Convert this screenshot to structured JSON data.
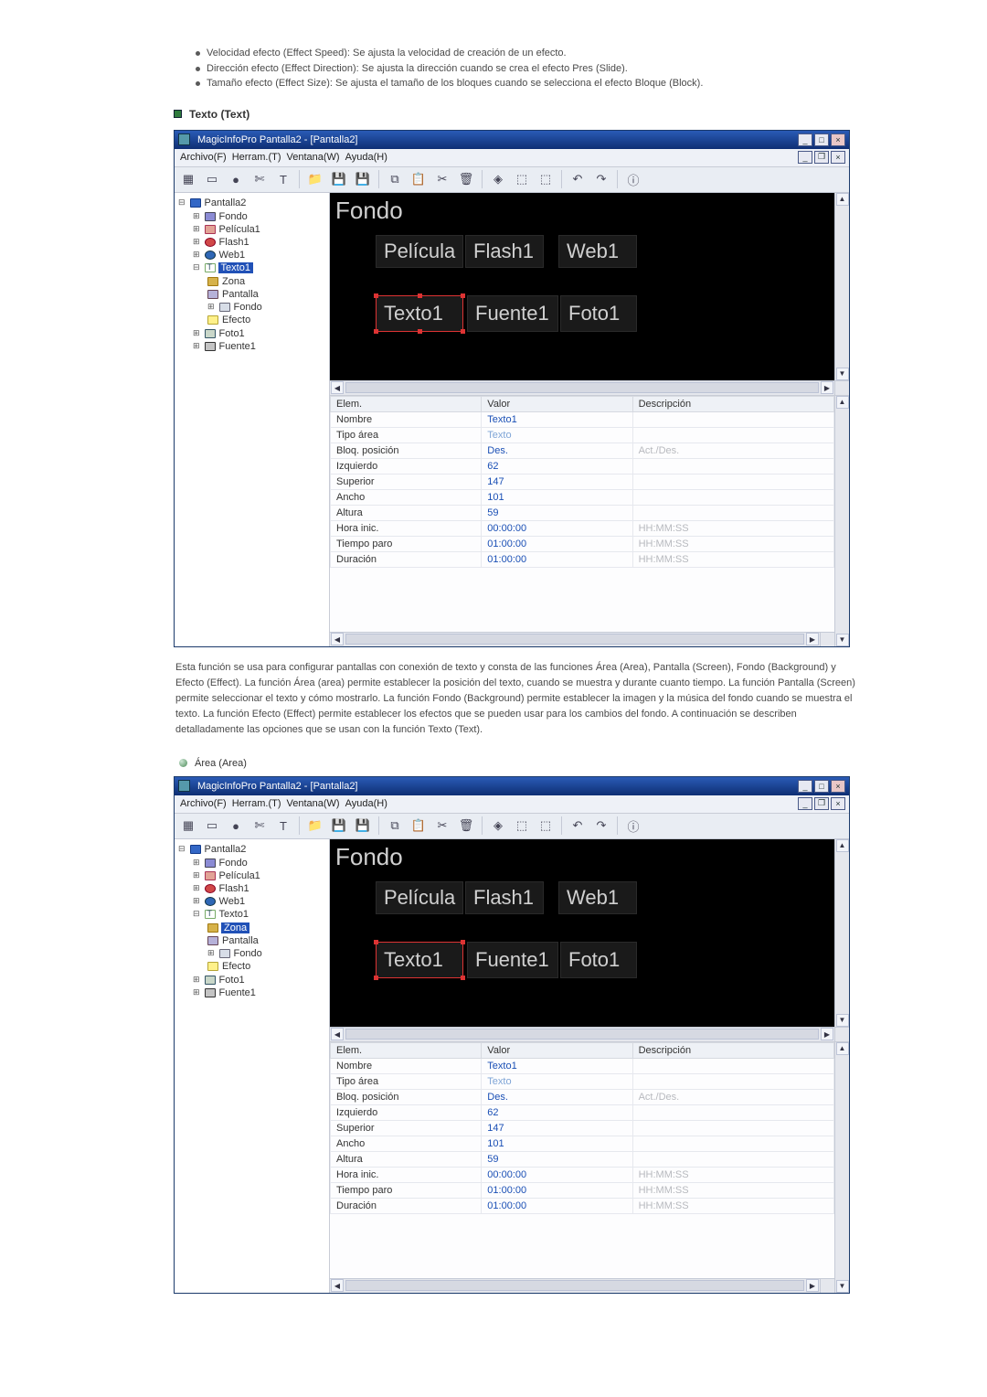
{
  "intro_bullets": [
    "Velocidad efecto (Effect Speed): Se ajusta la velocidad de creación de un efecto.",
    "Dirección efecto (Effect Direction): Se ajusta la dirección cuando se crea el efecto Pres (Slide).",
    "Tamaño efecto (Effect Size): Se ajusta el tamaño de los bloques cuando se selecciona el efecto Bloque (Block)."
  ],
  "heading_main": "Texto (Text)",
  "paragraph": "Esta función se usa para configurar pantallas con conexión de texto y consta de las funciones Área (Area), Pantalla (Screen), Fondo (Background) y Efecto (Effect). La función Área (area) permite establecer la posición del texto, cuando se muestra y durante cuanto tiempo. La función Pantalla (Screen) permite seleccionar el texto y cómo mostrarlo. La función Fondo (Background) permite establecer la imagen y la música del fondo cuando se muestra el texto. La función Efecto (Effect) permite establecer los efectos que se pueden usar para los cambios del fondo. A continuación se describen detalladamente las opciones que se usan con la función Texto (Text).",
  "heading_sub": "Área (Area)",
  "app1": {
    "title": "MagicInfoPro Pantalla2 - [Pantalla2]",
    "menus": [
      "Archivo(F)",
      "Herram.(T)",
      "Ventana(W)",
      "Ayuda(H)"
    ],
    "selected_node": "Texto1",
    "tree": {
      "root": "Pantalla2",
      "children": [
        "Fondo",
        "Película1",
        "Flash1",
        "Web1",
        "Texto1",
        "Foto1",
        "Fuente1"
      ],
      "texto_children": [
        "Zona",
        "Pantalla",
        "Fondo",
        "Efecto"
      ]
    },
    "canvas": {
      "bg_label": "Fondo",
      "row1": [
        "Película",
        "Flash1",
        "Web1"
      ],
      "row2": [
        "Texto1",
        "Fuente1",
        "Foto1"
      ],
      "selected": "Texto1"
    },
    "grid_headers": [
      "Elem.",
      "Valor",
      "Descripción"
    ],
    "grid_rows": [
      {
        "k": "Nombre",
        "v": "Texto1",
        "d": ""
      },
      {
        "k": "Tipo área",
        "v": "Texto",
        "d": ""
      },
      {
        "k": "Bloq. posición",
        "v": "Des.",
        "d": "Act./Des."
      },
      {
        "k": "Izquierdo",
        "v": "62",
        "d": ""
      },
      {
        "k": "Superior",
        "v": "147",
        "d": ""
      },
      {
        "k": "Ancho",
        "v": "101",
        "d": ""
      },
      {
        "k": "Altura",
        "v": "59",
        "d": ""
      },
      {
        "k": "Hora inic.",
        "v": "00:00:00",
        "d": "HH:MM:SS"
      },
      {
        "k": "Tiempo paro",
        "v": "01:00:00",
        "d": "HH:MM:SS"
      },
      {
        "k": "Duración",
        "v": "01:00:00",
        "d": "HH:MM:SS"
      }
    ]
  },
  "app2": {
    "title": "MagicInfoPro Pantalla2 - [Pantalla2]",
    "menus": [
      "Archivo(F)",
      "Herram.(T)",
      "Ventana(W)",
      "Ayuda(H)"
    ],
    "selected_node": "Zona",
    "tree": {
      "root": "Pantalla2",
      "children": [
        "Fondo",
        "Película1",
        "Flash1",
        "Web1",
        "Texto1",
        "Foto1",
        "Fuente1"
      ],
      "texto_children": [
        "Zona",
        "Pantalla",
        "Fondo",
        "Efecto"
      ]
    },
    "canvas": {
      "bg_label": "Fondo",
      "row1": [
        "Película",
        "Flash1",
        "Web1"
      ],
      "row2": [
        "Texto1",
        "Fuente1",
        "Foto1"
      ],
      "selected": "Texto1"
    },
    "grid_headers": [
      "Elem.",
      "Valor",
      "Descripción"
    ],
    "grid_rows": [
      {
        "k": "Nombre",
        "v": "Texto1",
        "d": ""
      },
      {
        "k": "Tipo área",
        "v": "Texto",
        "d": ""
      },
      {
        "k": "Bloq. posición",
        "v": "Des.",
        "d": "Act./Des."
      },
      {
        "k": "Izquierdo",
        "v": "62",
        "d": ""
      },
      {
        "k": "Superior",
        "v": "147",
        "d": ""
      },
      {
        "k": "Ancho",
        "v": "101",
        "d": ""
      },
      {
        "k": "Altura",
        "v": "59",
        "d": ""
      },
      {
        "k": "Hora inic.",
        "v": "00:00:00",
        "d": "HH:MM:SS"
      },
      {
        "k": "Tiempo paro",
        "v": "01:00:00",
        "d": "HH:MM:SS"
      },
      {
        "k": "Duración",
        "v": "01:00:00",
        "d": "HH:MM:SS"
      }
    ]
  }
}
